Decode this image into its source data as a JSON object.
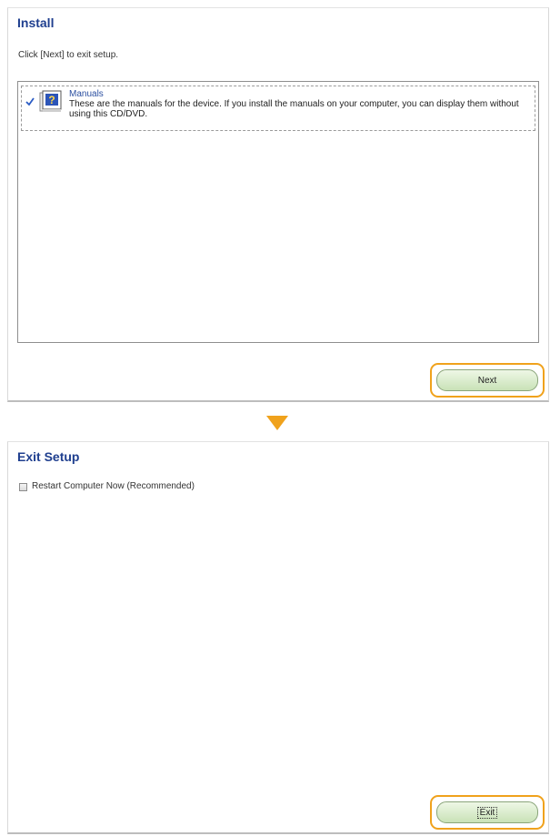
{
  "install": {
    "title": "Install",
    "instruction": "Click [Next] to exit setup.",
    "items": [
      {
        "name": "Manuals",
        "description": "These are the manuals for the device. If you install the manuals on your computer, you can display them without using this CD/DVD.",
        "checked": true,
        "icon": "manual-book-icon"
      }
    ],
    "next_label": "Next"
  },
  "step_arrow_icon": "down-arrow-icon",
  "exit_setup": {
    "title": "Exit Setup",
    "restart_label": "Restart Computer Now (Recommended)",
    "restart_checked": false,
    "exit_label": "Exit"
  },
  "colors": {
    "title": "#1f3f8f",
    "highlight": "#f0a21c",
    "button_fill": "#c9e2b7"
  }
}
